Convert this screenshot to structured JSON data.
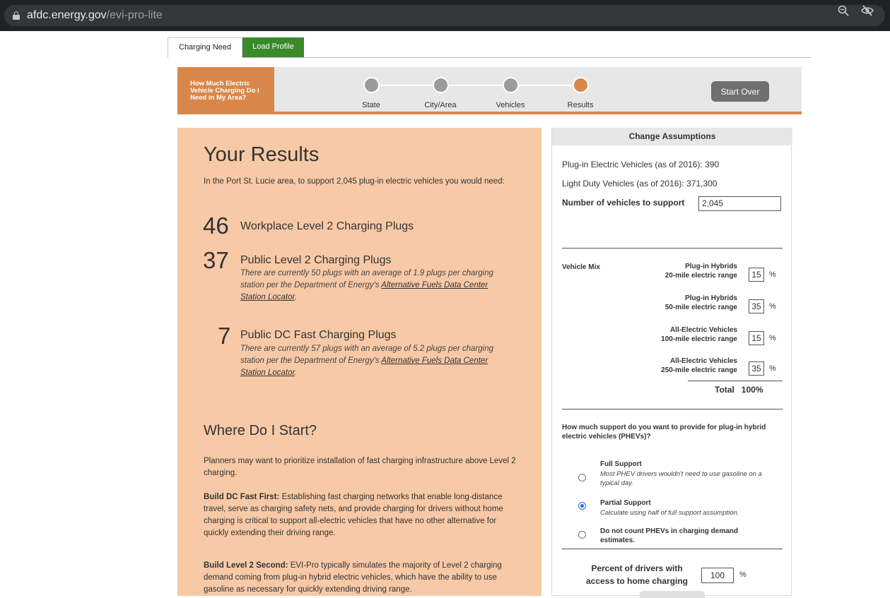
{
  "browser": {
    "domain": "afdc.energy.gov",
    "path": "/evi-pro-lite"
  },
  "tabs": [
    {
      "label": "Charging Need"
    },
    {
      "label": "Load Profile"
    }
  ],
  "banner": {
    "title": "How Much Electric Vehicle Charging Do I Need in My Area?",
    "steps": [
      {
        "label": "State"
      },
      {
        "label": "City/Area"
      },
      {
        "label": "Vehicles"
      },
      {
        "label": "Results"
      }
    ],
    "start_over": "Start Over"
  },
  "results": {
    "heading": "Your Results",
    "intro": "In the Port St. Lucie area, to support 2,045 plug-in electric vehicles you would need:",
    "items": [
      {
        "count": "46",
        "title": "Workplace Level 2 Charging Plugs"
      },
      {
        "count": "37",
        "title": "Public Level 2 Charging Plugs",
        "note": "There are currently 50 plugs with an average of 1.9 plugs per charging station per the Department of Energy's ",
        "link": "Alternative Fuels Data Center Station Locator",
        "end": "."
      },
      {
        "count": "7",
        "title": "Public DC Fast Charging Plugs",
        "note": "There are currently 57 plugs with an average of 5.2 plugs per charging station per the Department of Energy's ",
        "link": "Alternative Fuels Data Center Station Locator",
        "end": "."
      }
    ],
    "where_heading": "Where Do I Start?",
    "para1": "Planners may want to prioritize installation of fast charging infrastructure above Level 2 charging.",
    "para2_bold": "Build DC Fast First:",
    "para2": " Establishing fast charging networks that enable long-distance travel, serve as charging safety nets, and provide charging for drivers without home charging is critical to support all-electric vehicles that have no other alternative for quickly extending their driving range.",
    "para3_bold": "Build Level 2 Second:",
    "para3": " EVI-Pro typically simulates the majority of Level 2 charging demand coming from plug-in hybrid electric vehicles, which have the ability to use gasoline as necessary for quickly extending driving range."
  },
  "assumptions": {
    "heading": "Change Assumptions",
    "pev_line": "Plug-in Electric Vehicles (as of 2016): 390",
    "ldv_line": "Light Duty Vehicles (as of 2016): 371,300",
    "support_label": "Number of vehicles to support",
    "support_value": "2,045",
    "mix_label": "Vehicle Mix",
    "mix": [
      {
        "line1": "Plug-in Hybrids",
        "line2": "20-mile electric range",
        "value": "15"
      },
      {
        "line1": "Plug-in Hybrids",
        "line2": "50-mile electric range",
        "value": "35"
      },
      {
        "line1": "All-Electric Vehicles",
        "line2": "100-mile electric range",
        "value": "15"
      },
      {
        "line1": "All-Electric Vehicles",
        "line2": "250-mile electric range",
        "value": "35"
      }
    ],
    "pct_sign": "%",
    "total_label": "Total",
    "total_value": "100%",
    "question": "How much support do you want to provide for plug-in hybrid electric vehicles (PHEVs)?",
    "options": [
      {
        "title": "Full Support",
        "desc": "Most PHEV drivers wouldn't need to use gasoline on a typical day."
      },
      {
        "title": "Partial Support",
        "desc": "Calculate using half of full support assumption."
      },
      {
        "title": "Do not count PHEVs in charging demand estimates.",
        "desc": ""
      }
    ],
    "home_label": "Percent of drivers with access to home charging",
    "home_value": "100"
  }
}
